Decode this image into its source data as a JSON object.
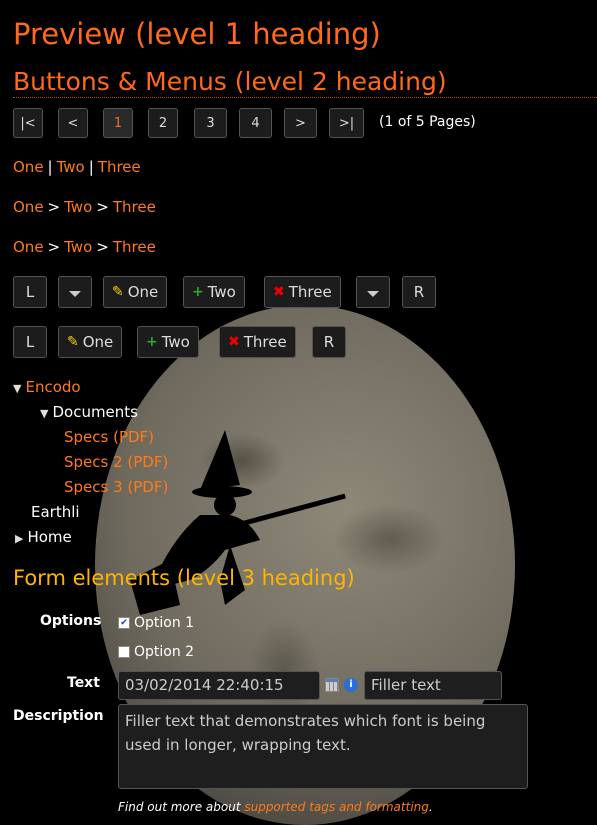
{
  "headings": {
    "h1": "Preview (level 1 heading)",
    "h2": "Buttons & Menus (level 2 heading)",
    "h3": "Form elements (level 3 heading)"
  },
  "pager": {
    "first": "|<",
    "prev": "<",
    "pages": [
      "1",
      "2",
      "3",
      "4"
    ],
    "current": "1",
    "next": ">",
    "last": ">|",
    "info": "(1 of 5 Pages)"
  },
  "menus": {
    "pipe": [
      "One",
      "Two",
      "Three"
    ],
    "pipe_sep": "|",
    "arrow": [
      "One",
      "Two",
      "Three"
    ],
    "arrow_sep": ">"
  },
  "toolbar1": {
    "left": "L",
    "one": "One",
    "two": "Two",
    "three": "Three",
    "right": "R"
  },
  "toolbar2": {
    "left": "L",
    "one": "One",
    "two": "Two",
    "three": "Three",
    "right": "R"
  },
  "tree": {
    "root": "Encodo",
    "folder": "Documents",
    "files": [
      "Specs (PDF)",
      "Specs 2 (PDF)",
      "Specs 3 (PDF)"
    ],
    "earthli": "Earthli",
    "home": "Home"
  },
  "form": {
    "options_label": "Options",
    "option1": "Option 1",
    "option1_checked": true,
    "option2": "Option 2",
    "option2_checked": false,
    "text_label": "Text",
    "date_value": "03/02/2014 22:40:15",
    "text_value": "Filler text",
    "description_label": "Description",
    "description_value": "Filler text that demonstrates which font is being used in longer, wrapping text."
  },
  "footer": {
    "prefix": "Find out more about ",
    "link": "supported tags and formatting",
    "suffix": "."
  },
  "colors": {
    "accent": "#ff6a1a",
    "heading3": "#ffb400",
    "background": "#000000"
  }
}
